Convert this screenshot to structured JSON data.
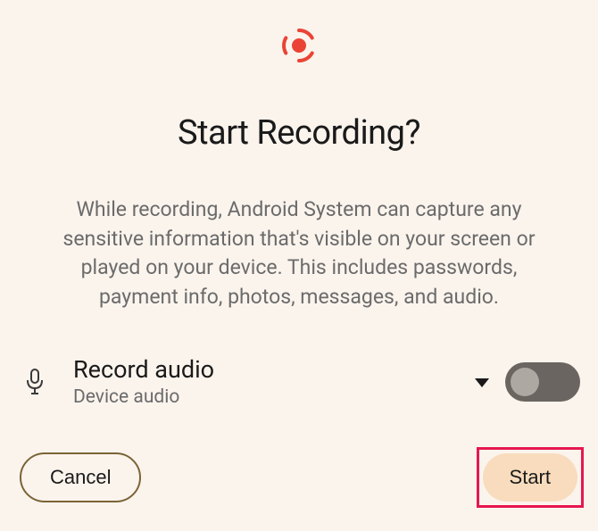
{
  "icon": "record-icon",
  "title": "Start Recording?",
  "body": "While recording, Android System can capture any sensitive information that's visible on your screen or played on your device. This includes passwords, payment info, photos, messages, and audio.",
  "audio_row": {
    "icon": "microphone-icon",
    "title": "Record audio",
    "subtitle": "Device audio",
    "toggle_on": false
  },
  "buttons": {
    "cancel": "Cancel",
    "start": "Start"
  },
  "colors": {
    "accent_red": "#ea4335",
    "highlight_border": "#e6174e",
    "start_bg": "#f8dcbd",
    "cancel_border": "#7a6436",
    "toggle_track": "#6a6560",
    "toggle_thumb": "#ada8a2"
  }
}
